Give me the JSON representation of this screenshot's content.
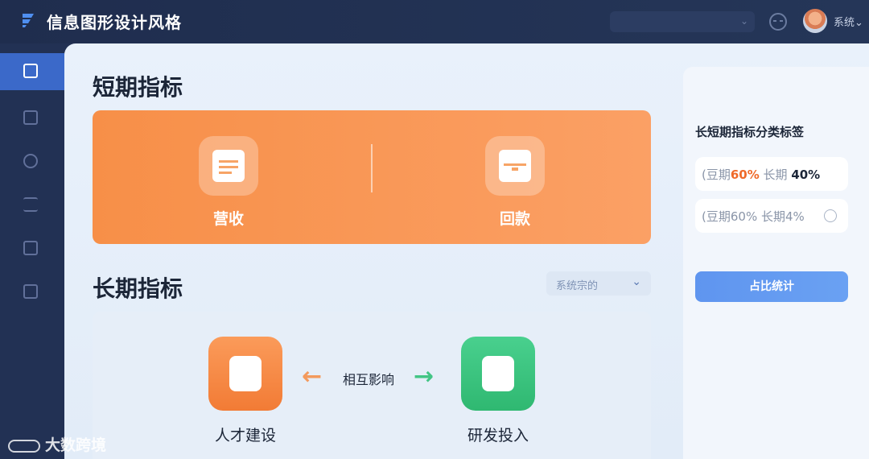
{
  "header": {
    "app_title": "信息图形设计风格",
    "user_name": "系统"
  },
  "sidebar": {
    "items": [
      {
        "icon": "dashboard-icon",
        "active": true
      },
      {
        "icon": "archive-icon",
        "active": false
      },
      {
        "icon": "people-icon",
        "active": false
      },
      {
        "icon": "list-icon",
        "active": false
      },
      {
        "icon": "document-icon",
        "active": false
      },
      {
        "icon": "report-icon",
        "active": false
      }
    ]
  },
  "short_term": {
    "title": "短期指标",
    "items": [
      {
        "label": "营收",
        "icon": "calendar-icon"
      },
      {
        "label": "回款",
        "icon": "toolbox-icon"
      }
    ]
  },
  "long_term": {
    "title": "长期指标",
    "select_value": "系统宗的",
    "left_label": "人才建设",
    "middle_label": "相互影响",
    "right_label": "研发投入",
    "left_icon": "document-signature-icon",
    "right_icon": "shield-chevron-icon"
  },
  "right_panel": {
    "title": "长短期指标分类标签",
    "card1": {
      "prefix": "(豆期",
      "short_value": "60%",
      "mid": " 长期 ",
      "long_value": "40%"
    },
    "card2": {
      "text": "(豆期60% 长期4%"
    },
    "button_label": "占比统计"
  },
  "watermark": "大数跨境",
  "colors": {
    "accent_orange": "#f78f48",
    "accent_green": "#43c585",
    "accent_blue": "#5f95ef",
    "nav_bg": "#223154"
  }
}
